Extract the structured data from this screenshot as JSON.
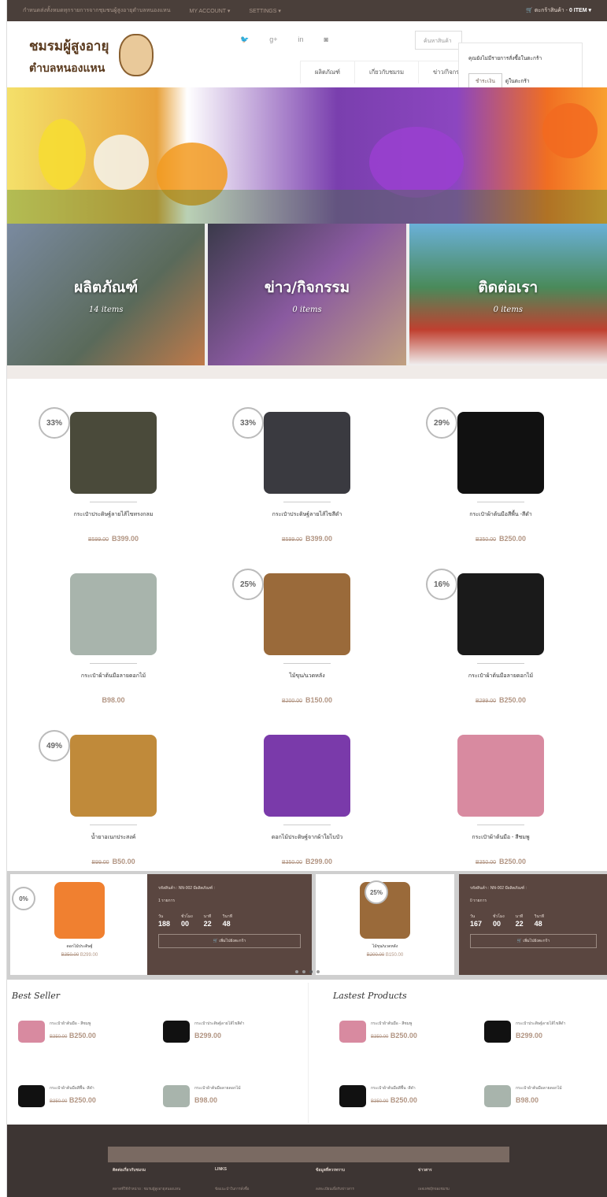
{
  "topbar": {
    "notice": "กำหนดส่งทั้งหมดทุกรายการจากชุมชนผู้สูงอายุตำบลหนองแหน",
    "account": "MY ACCOUNT ▾",
    "settings": "SETTINGS ▾",
    "cart": "ตะกร้าสินค้า -",
    "cart_count": "0 ITEM ▾"
  },
  "logo": {
    "line1": "ชมรมผู้สูงอายุ",
    "line2": "ตำบลหนองแหน"
  },
  "social": [
    "twitter-icon",
    "google-plus-icon",
    "linkedin-icon",
    "instagram-icon"
  ],
  "search": {
    "placeholder": "ค้นหาสินค้า"
  },
  "nav": [
    "ผลิตภัณฑ์",
    "เกี่ยวกับชมรม",
    "ข่าว/กิจกรรม"
  ],
  "dropdown": {
    "msg": "คุณยังไม่มีรายการสั่งซื้อในตะกร้า",
    "b1": "ชำระเงิน",
    "b2": "ดูในตะกร้า"
  },
  "tiles": [
    {
      "title": "ผลิตภัณฑ์",
      "count": "14 items",
      "color": "#5a6a7a"
    },
    {
      "title": "ข่าว/กิจกรรม",
      "count": "0 items",
      "color": "#6a5070"
    },
    {
      "title": "ติดต่อเรา",
      "count": "0 items",
      "color": "#5a8a70"
    }
  ],
  "products": [
    {
      "name": "กระเป๋าประดิษฐ์ลายไส้ไขทรงกลม",
      "old": "B599.00",
      "price": "B399.00",
      "badge": "33%",
      "color": "#4a4a3a"
    },
    {
      "name": "กระเป๋าประดิษฐ์ลายไส้ไขสีดำ",
      "old": "B599.00",
      "price": "B399.00",
      "badge": "33%",
      "color": "#3a3a40"
    },
    {
      "name": "กระเป๋าผ้าต้นมือสีพื้น -สีดำ",
      "old": "B350.00",
      "price": "B250.00",
      "badge": "29%",
      "color": "#111111"
    },
    {
      "name": "กระเป๋าผ้าต้นมือลายดอกไม้",
      "old": "",
      "price": "B98.00",
      "badge": "",
      "color": "#a8b4ac"
    },
    {
      "name": "ไม้ขุน/นวดหลัง",
      "old": "B200.00",
      "price": "B150.00",
      "badge": "25%",
      "color": "#9a6a3a"
    },
    {
      "name": "กระเป๋าผ้าต้นมือลายดอกไม้",
      "old": "B299.00",
      "price": "B250.00",
      "badge": "16%",
      "color": "#1a1a1a"
    },
    {
      "name": "น้ำยาอเนกประสงค์",
      "old": "B99.00",
      "price": "B50.00",
      "badge": "49%",
      "color": "#c08a3a"
    },
    {
      "name": "ดอกไม้ประดิษฐ์จากผ้าใยไบบัว",
      "old": "B350.00",
      "price": "B299.00",
      "badge": "",
      "color": "#7a3aaa"
    },
    {
      "name": "กระเป๋าผ้าต้นมือ - สีชมพู",
      "old": "B350.00",
      "price": "B250.00",
      "badge": "",
      "color": "#d88aa0"
    }
  ],
  "deals": [
    {
      "badge": "0%",
      "name": "ดอกไม้ประดิษฐ์",
      "old": "B350.00",
      "price": "B299.00",
      "code": "รหัสสินค้า : NN-002 มีผลิตภัณฑ์ :",
      "label": "1 รายการ",
      "days": "188",
      "hours": "00",
      "mins": "22",
      "secs": "48",
      "btn": "เพิ่มไปยังตะกร้า",
      "color": "#f08030"
    },
    {
      "badge": "25%",
      "name": "ไม้ขุน/นวดหลัง",
      "old": "B200.00",
      "price": "B150.00",
      "code": "รหัสสินค้า : NN-002 มีผลิตภัณฑ์ :",
      "label": "0 รายการ",
      "days": "167",
      "hours": "00",
      "mins": "22",
      "secs": "48",
      "btn": "เพิ่มไปยังตะกร้า",
      "color": "#9a6a3a"
    }
  ],
  "countdown_labels": {
    "d": "วัน",
    "h": "ชั่วโมง",
    "m": "นาที",
    "s": "วินาที"
  },
  "best": {
    "title": "Best Seller",
    "items": [
      {
        "name": "กระเป๋าผ้าต้นมือ - สีชมพู",
        "old": "B350.00",
        "price": "B250.00",
        "color": "#d88aa0"
      },
      {
        "name": "กระเป๋าประดิษฐ์ลายไส้ไขสีดำ",
        "old": "",
        "price": "B299.00",
        "color": "#111"
      },
      {
        "name": "กระเป๋าผ้าต้นมือสีพื้น -สีดำ",
        "old": "B350.00",
        "price": "B250.00",
        "color": "#111"
      },
      {
        "name": "กระเป๋าผ้าต้นมือลายดอกไม้",
        "old": "",
        "price": "B98.00",
        "color": "#a8b4ac"
      }
    ]
  },
  "latest": {
    "title": "Lastest Products",
    "items": [
      {
        "name": "กระเป๋าผ้าต้นมือ - สีชมพู",
        "old": "B350.00",
        "price": "B250.00",
        "color": "#d88aa0"
      },
      {
        "name": "กระเป๋าประดิษฐ์ลายไส้ไขสีดำ",
        "old": "",
        "price": "B299.00",
        "color": "#111"
      },
      {
        "name": "กระเป๋าผ้าต้นมือสีพื้น -สีดำ",
        "old": "B350.00",
        "price": "B250.00",
        "color": "#111"
      },
      {
        "name": "กระเป๋าผ้าต้นมือลายดอกไม้",
        "old": "",
        "price": "B98.00",
        "color": "#a8b4ac"
      }
    ]
  },
  "footer": {
    "cols": [
      "ติดต่อเกี่ยวกับชมรม",
      "LINKS",
      "ข้อมูลที่ควรทราบ",
      "ข่าวสาร"
    ],
    "subs": [
      "ตลาดที่ใช้จำหน่าย : ชมรมผู้สูงอายุหนองแหน",
      "ข้อแนะนำในการสั่งซื้อ",
      "ลงทะเบียนเพื่อรับข่าวสาร",
      "เพจเฟซบุ๊กของชมรม"
    ]
  }
}
